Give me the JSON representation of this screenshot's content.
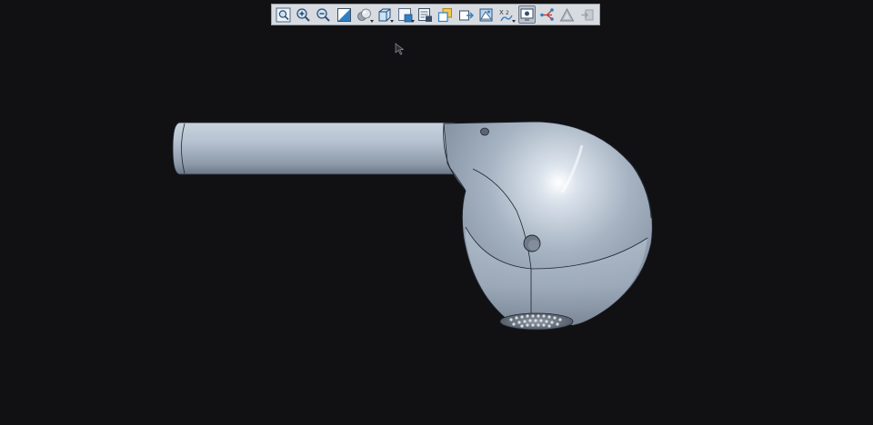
{
  "toolbar": {
    "buttons": [
      {
        "icon": "zoom-fit-icon",
        "active": false
      },
      {
        "icon": "zoom-in-icon",
        "active": false
      },
      {
        "icon": "zoom-out-icon",
        "active": false
      },
      {
        "icon": "zoom-area-icon",
        "active": false
      },
      {
        "icon": "display-style-icon",
        "active": false,
        "dropdown": true
      },
      {
        "icon": "view-orientation-icon",
        "active": false,
        "dropdown": true
      },
      {
        "icon": "section-view-icon",
        "active": false,
        "dropdown": true
      },
      {
        "icon": "display-pane-icon",
        "active": false
      },
      {
        "icon": "copy-view-icon",
        "active": false
      },
      {
        "icon": "hide-show-icon",
        "active": false
      },
      {
        "icon": "appearance-icon",
        "active": false
      },
      {
        "icon": "edit-scene-icon",
        "active": false
      },
      {
        "icon": "view-settings-icon",
        "active": true
      },
      {
        "icon": "curvature-icon",
        "active": false
      },
      {
        "icon": "render-icon",
        "active": false
      },
      {
        "icon": "exit-icon",
        "active": false
      }
    ]
  },
  "model": {
    "name": "earbud-3d-model",
    "body_color": "#aab6c4",
    "edge_color": "#1e2530"
  },
  "viewport": {
    "background": "#111113"
  }
}
